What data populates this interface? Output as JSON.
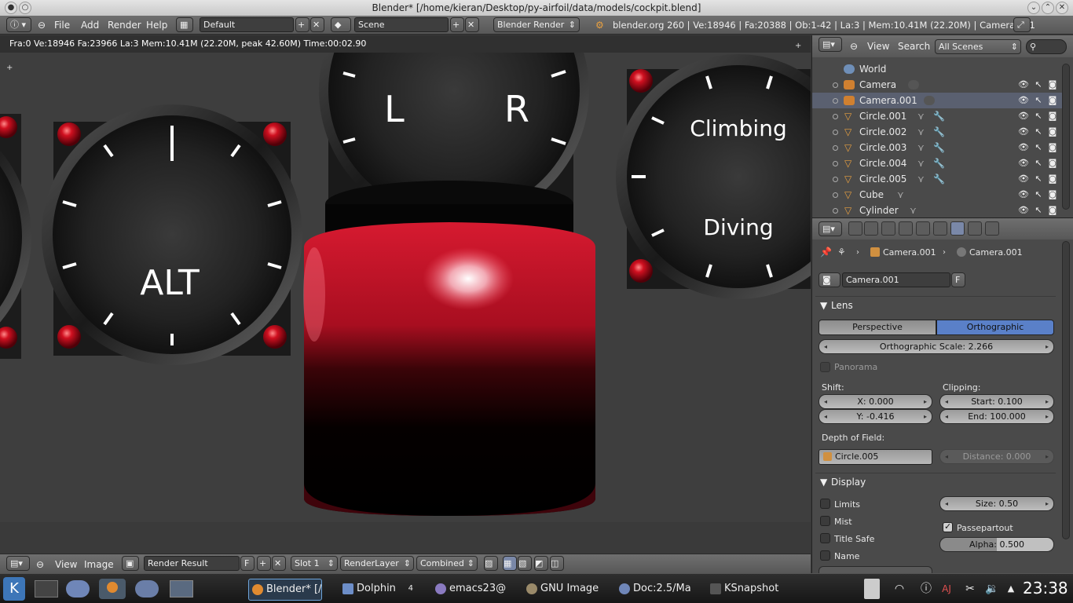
{
  "window": {
    "title": "Blender* [/home/kieran/Desktop/py-airfoil/data/models/cockpit.blend]"
  },
  "info_header": {
    "menus": [
      "File",
      "Add",
      "Render",
      "Help"
    ],
    "layout": "Default",
    "scene": "Scene",
    "engine": "Blender Render",
    "stats": "blender.org 260 | Ve:18946 | Fa:20388 | Ob:1-42 | La:3 | Mem:10.41M (22.20M) | Camera.001"
  },
  "viewport": {
    "render_stats": "Fra:0  Ve:18946 Fa:23966 La:3 Mem:10.41M (22.20M, peak 42.60M) Time:00:02.90",
    "gauge_labels": {
      "alt": "ALT",
      "left": "L",
      "right": "R",
      "climbing": "Climbing",
      "diving": "Diving"
    }
  },
  "image_header": {
    "menus": [
      "View",
      "Image"
    ],
    "image": "Render Result",
    "fake_user": "F",
    "slot": "Slot 1",
    "layer": "RenderLayer",
    "pass": "Combined"
  },
  "outliner": {
    "menus": [
      "View",
      "Search"
    ],
    "filter": "All Scenes",
    "items": [
      {
        "label": "World",
        "type": "world"
      },
      {
        "label": "Camera",
        "type": "camera"
      },
      {
        "label": "Camera.001",
        "type": "camera",
        "selected": true
      },
      {
        "label": "Circle.001",
        "type": "mesh"
      },
      {
        "label": "Circle.002",
        "type": "mesh"
      },
      {
        "label": "Circle.003",
        "type": "mesh"
      },
      {
        "label": "Circle.004",
        "type": "mesh"
      },
      {
        "label": "Circle.005",
        "type": "mesh"
      },
      {
        "label": "Cube",
        "type": "mesh"
      },
      {
        "label": "Cylinder",
        "type": "mesh"
      }
    ]
  },
  "properties": {
    "breadcrumb": [
      "Camera.001",
      "Camera.001"
    ],
    "datablock": "Camera.001",
    "fake_user": "F",
    "lens": {
      "title": "Lens",
      "perspective": "Perspective",
      "orthographic": "Orthographic",
      "ortho_scale": "Orthographic Scale: 2.266",
      "panorama": "Panorama",
      "shift_label": "Shift:",
      "shift_x": "X: 0.000",
      "shift_y": "Y: -0.416",
      "clipping_label": "Clipping:",
      "clip_start": "Start: 0.100",
      "clip_end": "End: 100.000",
      "dof_label": "Depth of Field:",
      "dof_object": "Circle.005",
      "distance": "Distance: 0.000"
    },
    "display": {
      "title": "Display",
      "limits": "Limits",
      "mist": "Mist",
      "title_safe": "Title Safe",
      "name": "Name",
      "size": "Size: 0.50",
      "passepartout": "Passepartout",
      "alpha": "Alpha: 0.500"
    }
  },
  "taskbar": {
    "tasks": [
      {
        "label": "Blender* [/"
      },
      {
        "label": "Dolphin",
        "badge": "4"
      },
      {
        "label": "emacs23@"
      },
      {
        "label": "GNU Image"
      },
      {
        "label": "Doc:2.5/Ma"
      },
      {
        "label": "KSnapshot"
      }
    ],
    "clock": "23:38",
    "kbd": "AJ"
  },
  "colors": {
    "accent": "#5a80c8",
    "knob_red": "#c8102e",
    "header": "#606060"
  }
}
